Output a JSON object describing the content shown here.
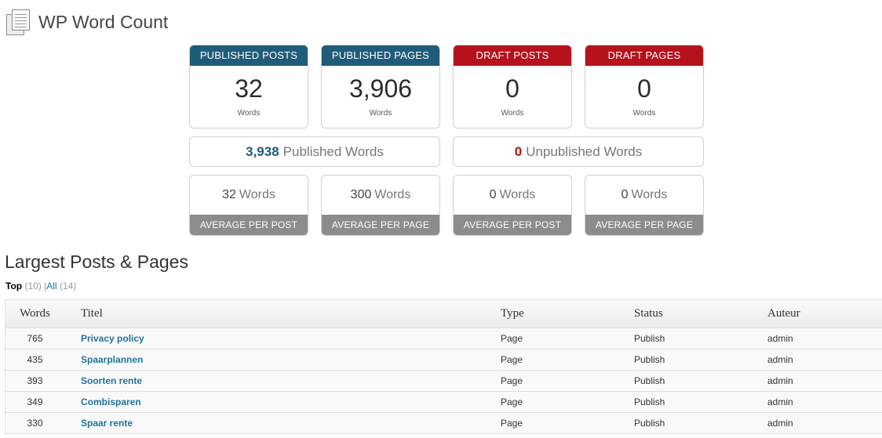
{
  "header": {
    "title": "WP Word Count",
    "icon": "document-pages-icon"
  },
  "stats": [
    {
      "label": "PUBLISHED POSTS",
      "value": "32",
      "unit": "Words",
      "color": "#1f5c7a"
    },
    {
      "label": "PUBLISHED PAGES",
      "value": "3,906",
      "unit": "Words",
      "color": "#1f5c7a"
    },
    {
      "label": "DRAFT POSTS",
      "value": "0",
      "unit": "Words",
      "color": "#b5121b"
    },
    {
      "label": "DRAFT PAGES",
      "value": "0",
      "unit": "Words",
      "color": "#b5121b"
    }
  ],
  "summary": {
    "published": {
      "value": "3,938",
      "label": "Published Words"
    },
    "unpublished": {
      "value": "0",
      "label": "Unpublished Words"
    }
  },
  "averages": [
    {
      "value": "32",
      "unit": "Words",
      "label": "AVERAGE PER POST"
    },
    {
      "value": "300",
      "unit": "Words",
      "label": "AVERAGE PER PAGE"
    },
    {
      "value": "0",
      "unit": "Words",
      "label": "AVERAGE PER POST"
    },
    {
      "value": "0",
      "unit": "Words",
      "label": "AVERAGE PER PAGE"
    }
  ],
  "largest": {
    "title": "Largest Posts & Pages",
    "filters": {
      "top_label": "Top",
      "top_count": "(10)",
      "separator": "|",
      "all_label": "All",
      "all_count": "(14)"
    },
    "columns": {
      "words": "Words",
      "title": "Titel",
      "type": "Type",
      "status": "Status",
      "author": "Auteur"
    },
    "rows": [
      {
        "words": "765",
        "title": "Privacy policy",
        "type": "Page",
        "status": "Publish",
        "author": "admin"
      },
      {
        "words": "435",
        "title": "Spaarplannen",
        "type": "Page",
        "status": "Publish",
        "author": "admin"
      },
      {
        "words": "393",
        "title": "Soorten rente",
        "type": "Page",
        "status": "Publish",
        "author": "admin"
      },
      {
        "words": "349",
        "title": "Combisparen",
        "type": "Page",
        "status": "Publish",
        "author": "admin"
      },
      {
        "words": "330",
        "title": "Spaar rente",
        "type": "Page",
        "status": "Publish",
        "author": "admin"
      }
    ]
  }
}
